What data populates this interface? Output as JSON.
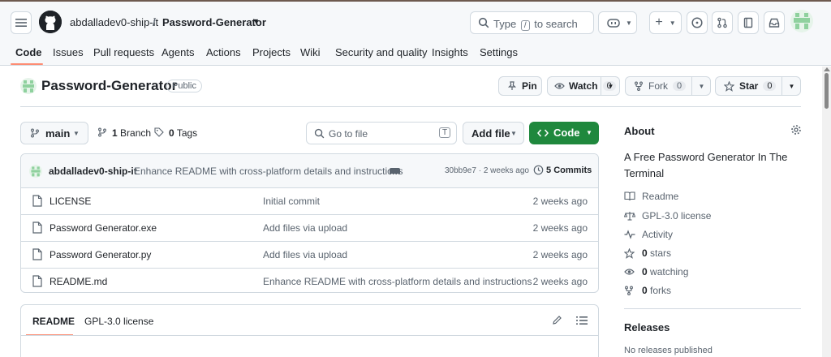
{
  "header": {
    "owner": "abdalladev0-ship-it",
    "separator": "/",
    "repo": "Password-Generator",
    "search_prefix": "Type",
    "search_key": "/",
    "search_suffix": "to search"
  },
  "tabs": [
    "Code",
    "Issues",
    "Pull requests",
    "Agents",
    "Actions",
    "Projects",
    "Wiki",
    "Security and quality",
    "Insights",
    "Settings"
  ],
  "repo": {
    "title": "Password-Generator",
    "visibility": "Public",
    "pin_label": "Pin",
    "watch_label": "Watch",
    "watch_count": "0",
    "fork_label": "Fork",
    "fork_count": "0",
    "star_label": "Star",
    "star_count": "0"
  },
  "toolbar": {
    "branch": "main",
    "branches_count": "1",
    "branches_label": "Branch",
    "tags_count": "0",
    "tags_label": "Tags",
    "goto_placeholder": "Go to file",
    "goto_key": "T",
    "add_file": "Add file",
    "code": "Code"
  },
  "commit": {
    "author": "abdalladev0-ship-it",
    "message": "Enhance README with cross-platform details and instructions",
    "hash_time": "30bb9e7 · 2 weeks ago",
    "commits_count": "5",
    "commits_label": "Commits"
  },
  "files": [
    {
      "name": "LICENSE",
      "message": "Initial commit",
      "age": "2 weeks ago"
    },
    {
      "name": "Password Generator.exe",
      "message": "Add files via upload",
      "age": "2 weeks ago"
    },
    {
      "name": "Password Generator.py",
      "message": "Add files via upload",
      "age": "2 weeks ago"
    },
    {
      "name": "README.md",
      "message": "Enhance README with cross-platform details and instructions",
      "age": "2 weeks ago"
    }
  ],
  "readme": {
    "tab_readme": "README",
    "tab_license": "GPL-3.0 license"
  },
  "about": {
    "title": "About",
    "description": "A Free Password Generator In The Terminal",
    "readme": "Readme",
    "license": "GPL-3.0 license",
    "activity": "Activity",
    "stars_count": "0",
    "stars_label": "stars",
    "watching_count": "0",
    "watching_label": "watching",
    "forks_count": "0",
    "forks_label": "forks"
  },
  "releases": {
    "title": "Releases",
    "none": "No releases published"
  },
  "colors": {
    "accent_green": "#1f883d",
    "tab_underline": "#fd8c73",
    "border": "#d1d9e0"
  }
}
